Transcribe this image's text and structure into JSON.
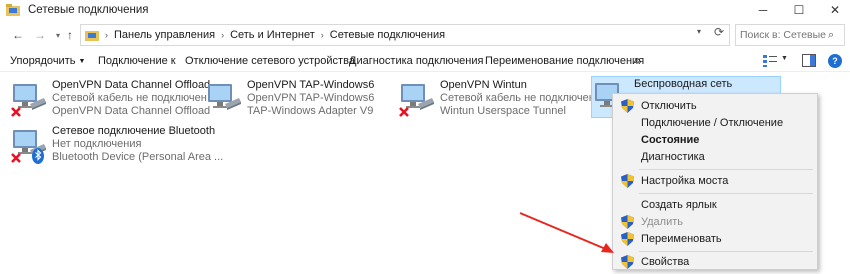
{
  "window": {
    "title": "Сетевые подключения",
    "controls": {
      "minimize": "─",
      "maximize": "☐",
      "close": "✕"
    }
  },
  "addressbar": {
    "breadcrumbs": [
      "Панель управления",
      "Сеть и Интернет",
      "Сетевые подключения"
    ],
    "separator": "›",
    "search_placeholder": "Поиск в: Сетевые подк..."
  },
  "commandbar": {
    "organize": "Упорядочить",
    "connect": "Подключение к",
    "disable": "Отключение сетевого устройства",
    "diagnose": "Диагностика подключения",
    "rename": "Переименование подключения",
    "more": "»"
  },
  "connections": [
    {
      "name": "OpenVPN Data Channel Offload",
      "status": "Сетевой кабель не подключен",
      "device": "OpenVPN Data Channel Offload",
      "state": "disconnected",
      "selected": false
    },
    {
      "name": "OpenVPN TAP-Windows6",
      "status": "OpenVPN TAP-Windows6",
      "device": "TAP-Windows Adapter V9",
      "state": "normal",
      "selected": false
    },
    {
      "name": "OpenVPN Wintun",
      "status": "Сетевой кабель не подключен",
      "device": "Wintun Userspace Tunnel",
      "state": "disconnected",
      "selected": false
    },
    {
      "name": "Беспроводная сеть",
      "status": "",
      "device": "",
      "state": "normal",
      "selected": true
    },
    {
      "name": "Сетевое подключение Bluetooth",
      "status": "Нет подключения",
      "device": "Bluetooth Device (Personal Area ...",
      "state": "bluetooth",
      "selected": false
    }
  ],
  "context_menu": {
    "items": [
      {
        "label": "Отключить",
        "shield": true,
        "bold": false,
        "disabled": false
      },
      {
        "label": "Подключение / Отключение",
        "shield": false,
        "bold": false,
        "disabled": false
      },
      {
        "label": "Состояние",
        "shield": false,
        "bold": true,
        "disabled": false
      },
      {
        "label": "Диагностика",
        "shield": false,
        "bold": false,
        "disabled": false
      },
      {
        "label": "Настройка моста",
        "shield": true,
        "bold": false,
        "disabled": false
      },
      {
        "label": "Создать ярлык",
        "shield": false,
        "bold": false,
        "disabled": false
      },
      {
        "label": "Удалить",
        "shield": true,
        "bold": false,
        "disabled": true
      },
      {
        "label": "Переименовать",
        "shield": true,
        "bold": false,
        "disabled": false
      },
      {
        "label": "Свойства",
        "shield": true,
        "bold": false,
        "disabled": false
      }
    ]
  },
  "colors": {
    "selection_bg": "#cce8ff",
    "annotation_arrow": "#e8261f",
    "error_x": "#e81123",
    "bluetooth": "#1f6fd1"
  },
  "icons": {
    "app": "network-folder-icon",
    "connection": "monitor-network-icon",
    "shield": "uac-shield-icon",
    "bluetooth": "bluetooth-icon",
    "error": "red-x-icon"
  }
}
